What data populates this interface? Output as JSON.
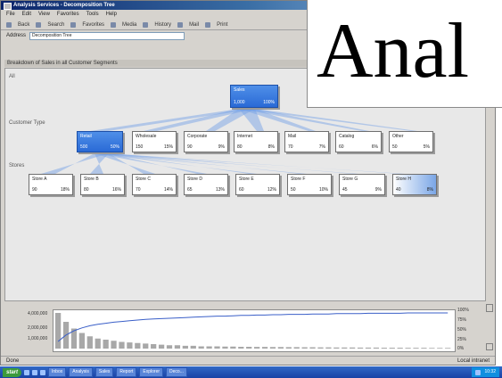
{
  "window": {
    "title": "Analysis Services - Decomposition Tree",
    "menu": [
      "File",
      "Edit",
      "View",
      "Favorites",
      "Tools",
      "Help"
    ],
    "toolbar": [
      "Back",
      "Search",
      "Favorites",
      "Media",
      "History",
      "Mail",
      "Print"
    ],
    "address_label": "Address",
    "address_value": "Decomposition Tree"
  },
  "section_title": "Breakdown of Sales in all Customer Segments",
  "levels": {
    "root": "All",
    "customer_type": "Customer Type",
    "stores": "Stores"
  },
  "root_node": {
    "label": "Sales",
    "value": "1,000",
    "pct": "100%"
  },
  "customer_type_nodes": [
    {
      "label": "Retail",
      "value": "500",
      "pct": "50%"
    },
    {
      "label": "Wholesale",
      "value": "150",
      "pct": "15%"
    },
    {
      "label": "Corporate",
      "value": "90",
      "pct": "9%"
    },
    {
      "label": "Internet",
      "value": "80",
      "pct": "8%"
    },
    {
      "label": "Mail",
      "value": "70",
      "pct": "7%"
    },
    {
      "label": "Catalog",
      "value": "60",
      "pct": "6%"
    },
    {
      "label": "Other",
      "value": "50",
      "pct": "5%"
    }
  ],
  "store_nodes": [
    {
      "label": "Store A",
      "value": "90",
      "pct": "18%"
    },
    {
      "label": "Store B",
      "value": "80",
      "pct": "16%"
    },
    {
      "label": "Store C",
      "value": "70",
      "pct": "14%"
    },
    {
      "label": "Store D",
      "value": "65",
      "pct": "13%"
    },
    {
      "label": "Store E",
      "value": "60",
      "pct": "12%"
    },
    {
      "label": "Store F",
      "value": "50",
      "pct": "10%"
    },
    {
      "label": "Store G",
      "value": "45",
      "pct": "9%"
    },
    {
      "label": "Store H",
      "value": "40",
      "pct": "8%"
    }
  ],
  "chart_data": {
    "type": "bar",
    "ylabel_left": [
      "4,000,000",
      "2,000,000",
      "1,000,000"
    ],
    "ylabel_right": [
      "100%",
      "75%",
      "50%",
      "25%",
      "0%"
    ],
    "values": [
      32,
      24,
      18,
      14,
      11,
      9,
      8,
      7,
      6,
      5.5,
      5,
      4.5,
      4,
      3.5,
      3,
      3,
      2.5,
      2.5,
      2,
      2,
      2,
      1.8,
      1.8,
      1.6,
      1.6,
      1.5,
      1.5,
      1.4,
      1.4,
      1.3,
      1.3,
      1.2,
      1.2,
      1.1,
      1.1,
      1,
      1,
      1,
      0.9,
      0.9,
      0.9,
      0.8,
      0.8,
      0.8,
      0.7,
      0.7,
      0.7,
      0.6,
      0.6,
      0.6
    ],
    "cumulative_pct": [
      20,
      38,
      50,
      58,
      64,
      68,
      71,
      74,
      76,
      78,
      80,
      82,
      83,
      84,
      85,
      86,
      87,
      88,
      89,
      90,
      91,
      91,
      92,
      93,
      93,
      94,
      94,
      95,
      95,
      96,
      96,
      96,
      97,
      97,
      97,
      98,
      98,
      98,
      98,
      99,
      99,
      99,
      99,
      99,
      100,
      100,
      100,
      100,
      100,
      100
    ],
    "colors": {
      "bars": "#a8a8a8",
      "line": "#3a5fc8"
    }
  },
  "statusbar": {
    "left": "Done",
    "right": "Local intranet"
  },
  "taskbar": {
    "start": "start",
    "items": [
      "Inbox",
      "Analysis",
      "Sales",
      "Report",
      "Explorer",
      "Deco..."
    ],
    "clock": "10:32"
  },
  "overlay_text": "Anal"
}
